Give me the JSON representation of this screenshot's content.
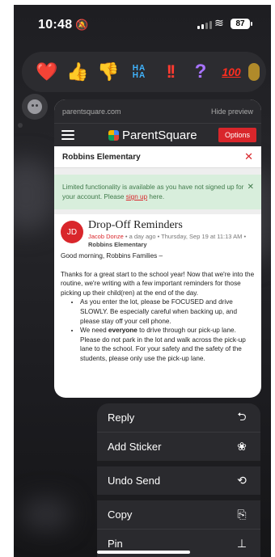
{
  "status": {
    "time": "10:48",
    "battery": "87"
  },
  "tapbacks": [
    {
      "name": "heart-icon",
      "glyph": "❤️"
    },
    {
      "name": "thumbs-up-icon",
      "glyph": "👍"
    },
    {
      "name": "thumbs-down-icon",
      "glyph": "👎"
    },
    {
      "name": "haha-icon",
      "glyph": "HA HA"
    },
    {
      "name": "exclamation-icon",
      "glyph": "!!"
    },
    {
      "name": "question-icon",
      "glyph": "?"
    },
    {
      "name": "hundred-icon",
      "glyph": "100"
    }
  ],
  "preview": {
    "domain": "parentsquare.com",
    "hide_label": "Hide preview",
    "app_name": "ParentSquare",
    "options_label": "Options",
    "school": "Robbins Elementary",
    "close_glyph": "✕",
    "notice_text": "Limited functionality is available as you have not signed up for your account. Please ",
    "notice_link": "sign up",
    "notice_end": " here.",
    "post": {
      "avatar": "JD",
      "title": "Drop-Off Reminders",
      "author": "Jacob Donze",
      "meta": " • a day ago • Thursday, Sep 19 at 11:13 AM • ",
      "school": "Robbins Elementary",
      "greeting": "Good morning, Robbins Families –",
      "intro": "Thanks for a great start to the school year! Now that we're into the routine, we're writing with a few important reminders for those picking up their child(ren) at the end of the day.",
      "bullet1": "As you enter the lot, please be FOCUSED and drive SLOWLY. Be especially careful when backing up, and please stay off your cell phone.",
      "bullet2_pre": "We need ",
      "bullet2_bold": "everyone",
      "bullet2_post": " to drive through our pick-up lane. Please do not park in the lot and walk across the pick-up lane to the school. For your safety and the safety of the students, please only use the pick-up lane."
    }
  },
  "menu": [
    {
      "label": "Reply",
      "icon": "reply-icon",
      "glyph": "⮌"
    },
    {
      "label": "Add Sticker",
      "icon": "sticker-icon",
      "glyph": "❀"
    },
    {
      "label": "Undo Send",
      "icon": "undo-icon",
      "glyph": "⟲"
    },
    {
      "label": "Copy",
      "icon": "copy-icon",
      "glyph": "⎘"
    },
    {
      "label": "Pin",
      "icon": "pin-icon",
      "glyph": "†"
    }
  ]
}
